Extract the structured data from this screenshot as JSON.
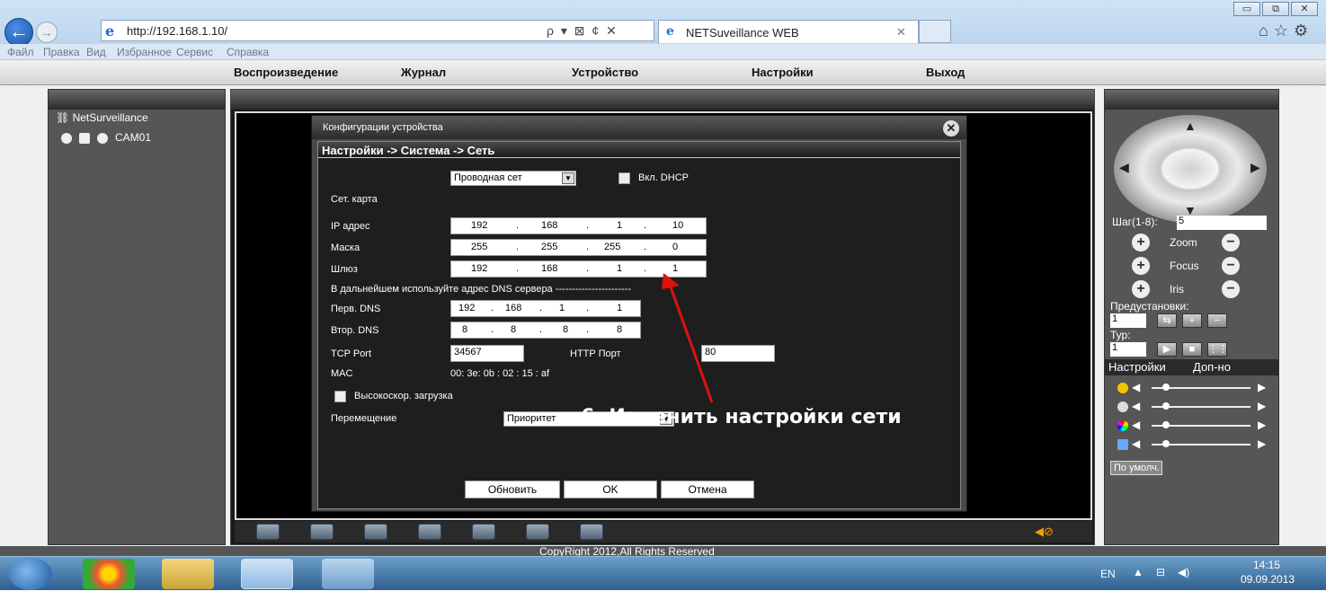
{
  "browser": {
    "url": "http://192.168.1.10/",
    "tab_title": "NETSuveillance WEB",
    "address_tools": "ρ ▾ ⊠ ¢ ✕",
    "menu": [
      "Файл",
      "Правка",
      "Вид",
      "Избранное",
      "Сервис",
      "Справка"
    ]
  },
  "app": {
    "nav": [
      "Воспроизведение",
      "Журнал",
      "Устройство",
      "Настройки",
      "Выход"
    ],
    "tree_root": "NetSurveillance",
    "camera": "CAM01",
    "footer": "CopyRight 2012,All Rights Reserved"
  },
  "ptz": {
    "step_label": "Шаг(1-8):",
    "step_value": "5",
    "zoom": "Zoom",
    "focus": "Focus",
    "iris": "Iris",
    "presets_label": "Предустановки:",
    "preset_value": "1",
    "tour_label": "Тур:",
    "tour_value": "1",
    "tab_settings": "Настройки",
    "tab_extra": "Доп-но",
    "reset": "По умолч."
  },
  "dialog": {
    "title": "Конфигурации устройства",
    "breadcrumb": "Настройки -> Система -> Сеть",
    "netcard_label": "Сет. карта",
    "netcard_value": "Проводная сет",
    "dhcp_label": "Вкл. DHCP",
    "ip_label": "IP адрес",
    "ip": [
      "192",
      "168",
      "1",
      "10"
    ],
    "mask_label": "Маска",
    "mask": [
      "255",
      "255",
      "255",
      "0"
    ],
    "gateway_label": "Шлюз",
    "gateway": [
      "192",
      "168",
      "1",
      "1"
    ],
    "dns_note": "В дальнейшем используйте адрес DNS сервера -----------------------",
    "dns1_label": "Перв. DNS",
    "dns1": [
      "192",
      "168",
      "1",
      "1"
    ],
    "dns2_label": "Втор. DNS",
    "dns2": [
      "8",
      "8",
      "8",
      "8"
    ],
    "tcp_label": "TCP Port",
    "tcp_value": "34567",
    "http_label": "HTTP Порт",
    "http_value": "80",
    "mac_label": "MAC",
    "mac_value": "00: 3e: 0b : 02 : 15 : af",
    "hs_label": "Высокоскор. загрузка",
    "transfer_label": "Перемещение",
    "transfer_value": "Приоритет",
    "btn_refresh": "Обновить",
    "btn_ok": "OK",
    "btn_cancel": "Отмена"
  },
  "annotation": "6. Изменить настройки сети",
  "taskbar": {
    "lang": "EN",
    "time": "14:15",
    "date": "09.09.2013"
  },
  "colors": {
    "annotation_arrow": "#e01010",
    "dialog_bg": "#1e1e1e"
  }
}
